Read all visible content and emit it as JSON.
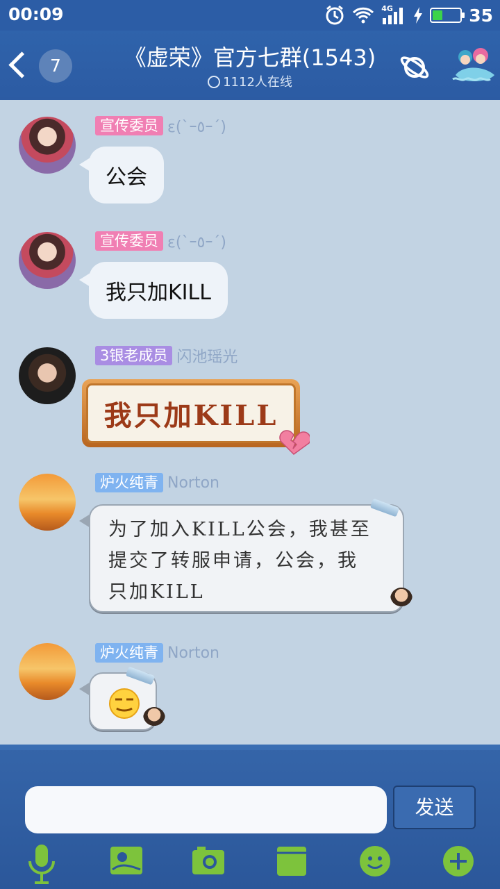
{
  "status_bar": {
    "time": "00:09",
    "network": "4G",
    "battery_level": "35",
    "battery_fraction": 0.35
  },
  "header": {
    "unread_count": "7",
    "title": "《虚荣》官方七群(1543)",
    "online_text": "1112人在线"
  },
  "messages": [
    {
      "badge": "宣传委员",
      "badge_color": "#f07fb3",
      "nickname": "ε(`ｰ٥ｰ´)",
      "type": "text",
      "text": "公会"
    },
    {
      "badge": "宣传委员",
      "badge_color": "#f07fb3",
      "nickname": "ε(`ｰ٥ｰ´)",
      "type": "text",
      "text": "我只加KILL"
    },
    {
      "badge": "3银老成员",
      "badge_color": "#a98de3",
      "nickname": "闪池瑶光",
      "type": "sticker",
      "text": "我只加KILL"
    },
    {
      "badge": "炉火纯青",
      "badge_color": "#7fb3f0",
      "nickname": "Norton",
      "type": "paper",
      "lines": [
        "为了加入KILL公会，我甚至",
        "提交了转服申请，公会，我",
        "只加KILL"
      ]
    },
    {
      "badge": "炉火纯青",
      "badge_color": "#7fb3f0",
      "nickname": "Norton",
      "type": "emoji",
      "emoji": "smirk-emoji"
    }
  ],
  "input": {
    "placeholder": "",
    "send_label": "发送"
  },
  "toolbar": [
    "mic-icon",
    "image-icon",
    "camera-icon",
    "card-icon",
    "emoji-icon",
    "plus-icon"
  ]
}
